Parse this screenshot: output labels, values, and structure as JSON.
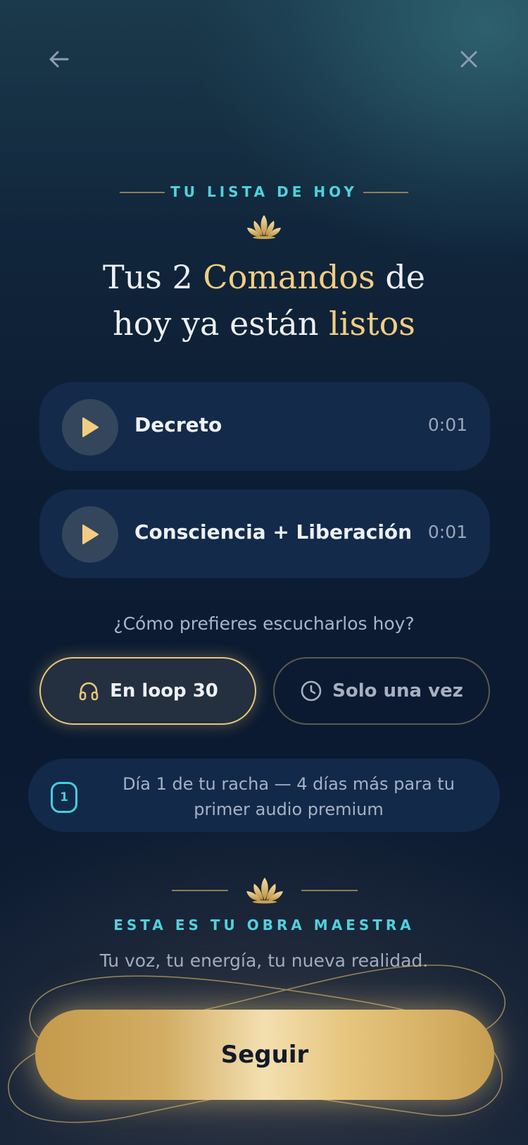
{
  "nav": {
    "back_icon": "arrow-left-icon",
    "close_icon": "close-icon"
  },
  "header": {
    "eyebrow": "TU LISTA DE HOY",
    "title_parts": [
      "Tus 2 ",
      "Comandos",
      " de",
      "hoy ya están ",
      "listos"
    ]
  },
  "tracks": [
    {
      "title": "Decreto",
      "duration": "0:01"
    },
    {
      "title": "Consciencia + Liberación",
      "duration": "0:01"
    }
  ],
  "mode": {
    "question": "¿Cómo prefieres escucharlos hoy?",
    "options": [
      {
        "label": "En loop 30",
        "icon": "headphones-icon",
        "selected": true
      },
      {
        "label": "Solo una vez",
        "icon": "clock-icon",
        "selected": false
      }
    ]
  },
  "streak": {
    "badge": "1",
    "text": "Día 1 de tu racha — 4 días más para tu primer audio premium"
  },
  "footer": {
    "eyebrow": "ESTA ES TU OBRA MAESTRA",
    "tagline": "Tu voz, tu energía, tu nueva realidad.",
    "cta_label": "Seguir"
  },
  "colors": {
    "accent_gold": "#f1cd81",
    "accent_cyan": "#4fd2de",
    "card": "#132a4a"
  }
}
